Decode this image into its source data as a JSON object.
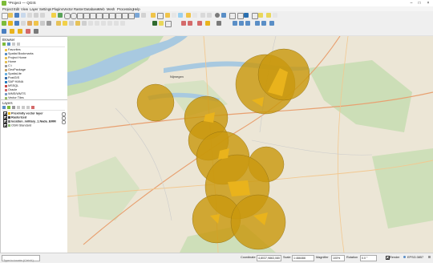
{
  "window": {
    "title": "*Project — QGIS"
  },
  "menu": [
    "Project",
    "Edit",
    "View",
    "Layer",
    "Settings",
    "Plugins",
    "Vector",
    "Raster",
    "Database",
    "Web",
    "Mesh",
    "Processing",
    "Help"
  ],
  "browser": {
    "title": "Browser",
    "items": [
      "Favorites",
      "Spatial Bookmarks",
      "Project Home",
      "Home",
      "C:\\",
      "GeoPackage",
      "SpatiaLite",
      "PostGIS",
      "SAP HANA",
      "MSSQL",
      "Oracle",
      "WMS/WMTS",
      "Vector Tiles"
    ]
  },
  "layers": {
    "title": "Layers",
    "items": [
      {
        "name": "Proximity vector layer",
        "checked": true,
        "bold": true,
        "swatch": "#e8b400"
      },
      {
        "name": "Rasterized",
        "checked": true,
        "bold": true,
        "swatch": "#444444"
      },
      {
        "name": "location_military_1.Nada_EMM",
        "checked": true,
        "bold": true,
        "swatch": "#7a7a7a"
      },
      {
        "name": "OSM Standard",
        "checked": true,
        "bold": false,
        "swatch": "#8ab870"
      }
    ]
  },
  "search": {
    "placeholder": "Type to locate (Ctrl+K)"
  },
  "status": {
    "coordinate_label": "Coordinate",
    "coordinate_value": "4,8037,9863,080",
    "scale_label": "Scale",
    "scale_value": "1:466466",
    "magnifier_label": "Magnifier",
    "magnifier_value": "100%",
    "rotation_label": "Rotation",
    "rotation_value": "0.0 °",
    "render_label": "Render",
    "crs": "EPSG:3857"
  },
  "map": {
    "place_label": "Nijmegen",
    "buffer_color": "#d4a017",
    "core_color": "#e9b31c",
    "water_color": "#a8c9e0",
    "green_color": "#b7d8a2"
  }
}
